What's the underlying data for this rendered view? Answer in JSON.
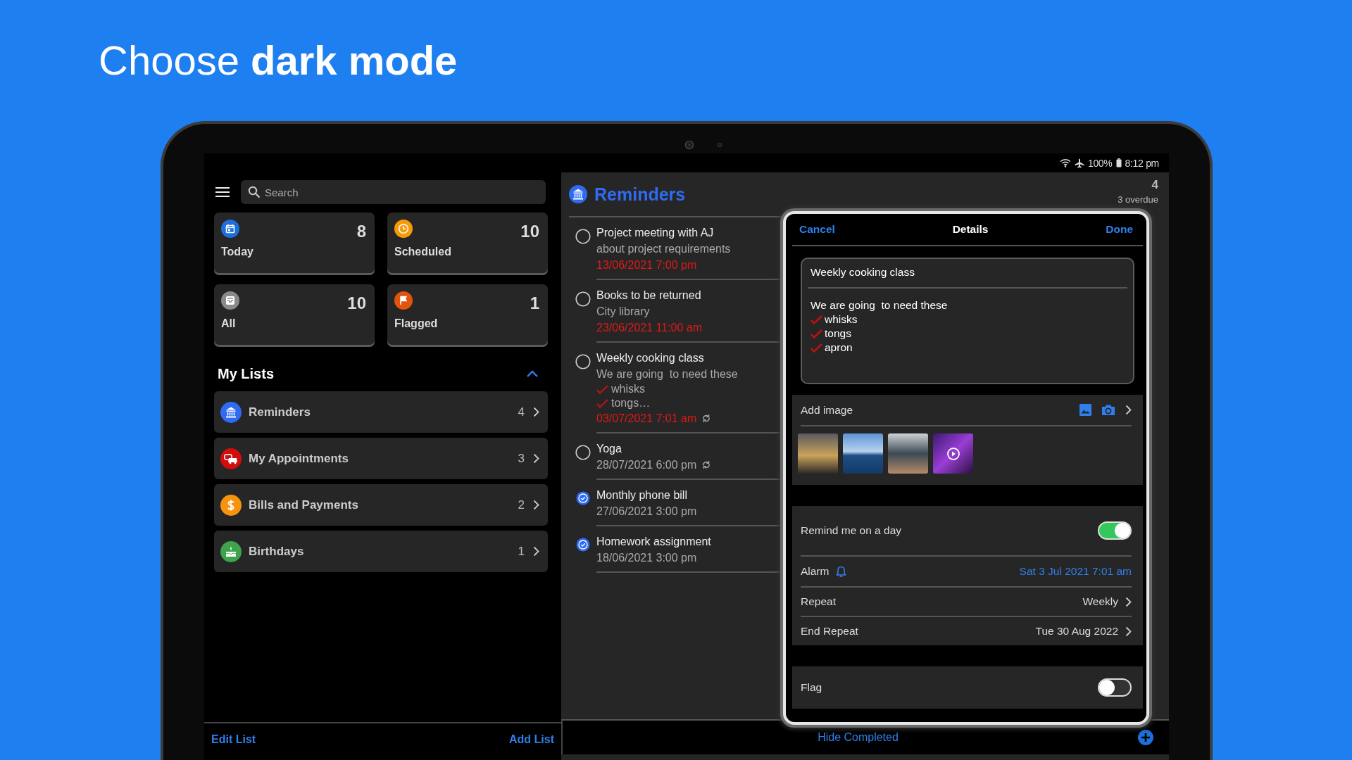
{
  "headline": "Choose **dark mode**",
  "status_bar": {
    "battery": "100%",
    "time": "8:12 pm"
  },
  "sidebar": {
    "search": {
      "placeholder": "Search"
    },
    "smart_lists": [
      {
        "kind": "calendar",
        "label": "Today",
        "count": "8",
        "color": "#1e6fd9"
      },
      {
        "kind": "clock",
        "label": "Scheduled",
        "count": "10",
        "color": "#f59b0b"
      },
      {
        "kind": "tray",
        "label": "All",
        "count": "10",
        "color": "#8a8a8a"
      },
      {
        "kind": "flag",
        "label": "Flagged",
        "count": "1",
        "color": "#e2530e"
      }
    ],
    "my_lists": {
      "title": "My Lists",
      "expanded": true,
      "items": [
        {
          "kind": "bank",
          "name": "Reminders",
          "count": "4",
          "color": "#2f6bf2"
        },
        {
          "kind": "cars",
          "name": "My Appointments",
          "count": "3",
          "color": "#d10d0d"
        },
        {
          "kind": "dollar",
          "name": "Bills and Payments",
          "count": "2",
          "color": "#f7940e"
        },
        {
          "kind": "cake",
          "name": "Birthdays",
          "count": "1",
          "color": "#3fa34d"
        }
      ]
    },
    "footer": {
      "edit": "Edit List",
      "add": "Add List"
    }
  },
  "list": {
    "title": "Reminders",
    "count": "4",
    "overdue": "3 overdue",
    "items": [
      {
        "title": "Project meeting with AJ",
        "notes": [
          "about project requirements"
        ],
        "date": "13/06/2021 7:00 pm",
        "overdue": true,
        "repeats": false,
        "completed": false
      },
      {
        "title": "Books to be returned",
        "notes": [
          "City library"
        ],
        "date": "23/06/2021 11:00 am",
        "overdue": true,
        "repeats": false,
        "completed": false
      },
      {
        "title": "Weekly cooking class",
        "notes": [
          "We are going  to need these"
        ],
        "checklist": [
          "whisks",
          "tongs…"
        ],
        "date": "03/07/2021 7:01 am",
        "overdue": true,
        "repeats": true,
        "completed": false
      },
      {
        "title": "Yoga",
        "date": "28/07/2021 6:00 pm",
        "overdue": false,
        "repeats": true,
        "completed": false
      },
      {
        "title": "Monthly phone bill",
        "date": "27/06/2021 3:00 pm",
        "overdue": false,
        "repeats": false,
        "completed": true
      },
      {
        "title": "Homework assignment",
        "date": "18/06/2021 3:00 pm",
        "overdue": false,
        "repeats": false,
        "completed": true
      }
    ],
    "footer": "Hide Completed"
  },
  "details": {
    "cancel": "Cancel",
    "title": "Details",
    "done": "Done",
    "note": {
      "title": "Weekly cooking class",
      "body": "We are going  to need these",
      "checklist": [
        "whisks",
        "tongs",
        "apron"
      ]
    },
    "add_image": "Add image",
    "images": [
      {
        "kind": "photo"
      },
      {
        "kind": "photo"
      },
      {
        "kind": "photo"
      },
      {
        "kind": "video"
      }
    ],
    "rows": [
      {
        "kind": "toggle",
        "label": "Remind me on a day",
        "on": true
      },
      {
        "kind": "alarm",
        "label": "Alarm",
        "value": "Sat 3 Jul 2021 7:01 am"
      },
      {
        "kind": "link",
        "label": "Repeat",
        "value": "Weekly"
      },
      {
        "kind": "link",
        "label": "End Repeat",
        "value": "Tue 30 Aug 2022"
      }
    ],
    "flag": {
      "label": "Flag",
      "on": false
    }
  }
}
